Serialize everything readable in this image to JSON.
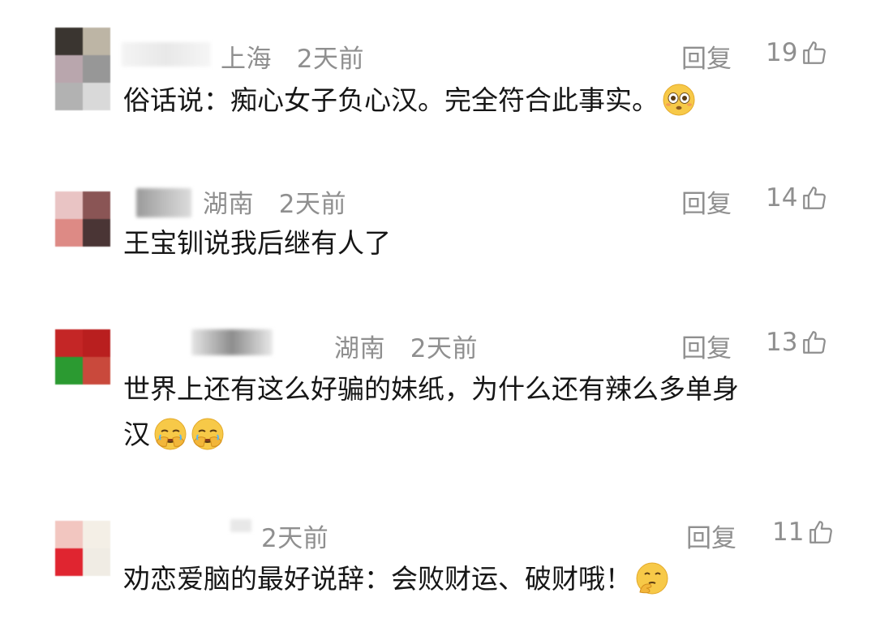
{
  "comments": [
    {
      "location": "上海",
      "time": "2天前",
      "reply_label": "回复",
      "likes": "19",
      "text": "俗话说：痴心女子负心汉。完全符合此事实。",
      "emoji": "flushed-face",
      "avatar_colors": [
        "#3a3530",
        "#bdb5a5",
        "#b9a6ad",
        "#979797",
        "#b2b2b2",
        "#d9d9d9"
      ]
    },
    {
      "location": "湖南",
      "time": "2天前",
      "reply_label": "回复",
      "likes": "14",
      "text": "王宝钏说我后继有人了",
      "emoji": "",
      "avatar_colors": [
        "#e9c4c4",
        "#8a5555",
        "#dd8a85",
        "#4a3535"
      ]
    },
    {
      "location": "湖南",
      "time": "2天前",
      "reply_label": "回复",
      "likes": "13",
      "text_line1": "世界上还有这么好骗的妹纸，为什么还有辣么多单身",
      "text_line2": "汉",
      "emoji": "face-palm",
      "emoji_count": 2,
      "avatar_colors": [
        "#c42626",
        "#b91f1f",
        "#2b9a31",
        "#c9493c"
      ]
    },
    {
      "location": "",
      "time": "2天前",
      "reply_label": "回复",
      "likes": "11",
      "text": "劝恋爱脑的最好说辞：会败财运、破财哦！",
      "emoji": "thinking-face",
      "avatar_colors": [
        "#f2c6c0",
        "#f4efe6",
        "#e02530",
        "#f0ece4"
      ]
    }
  ]
}
